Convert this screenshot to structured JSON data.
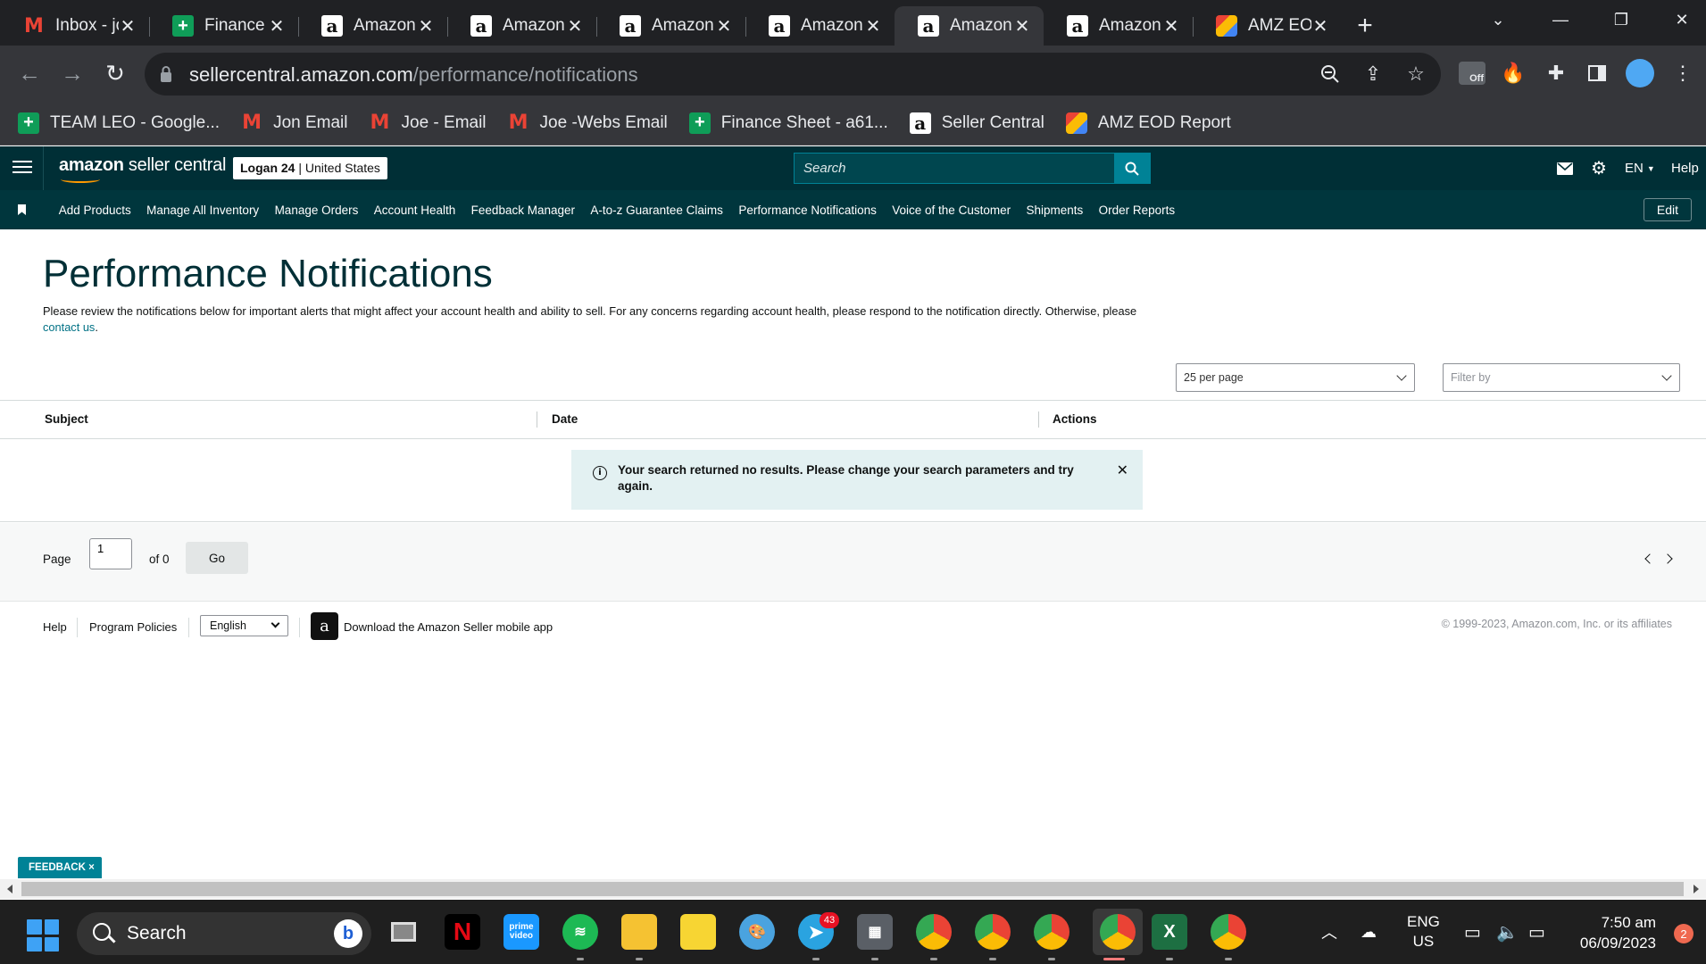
{
  "browser": {
    "tabs": [
      {
        "title": "Inbox - jo",
        "favicon": "gmail-icon"
      },
      {
        "title": "Finance S",
        "favicon": "sheets-icon"
      },
      {
        "title": "Amazon",
        "favicon": "amazon-icon"
      },
      {
        "title": "Amazon",
        "favicon": "amazon-icon"
      },
      {
        "title": "Amazon",
        "favicon": "amazon-icon"
      },
      {
        "title": "Amazon",
        "favicon": "amazon-icon"
      },
      {
        "title": "Amazon",
        "favicon": "amazon-icon",
        "active": true
      },
      {
        "title": "Amazon",
        "favicon": "amazon-icon"
      },
      {
        "title": "AMZ EOI",
        "favicon": "amz-eod-icon"
      }
    ],
    "url_host": "sellercentral.amazon.com",
    "url_path": "/performance/notifications",
    "extension_badge": "Off",
    "bookmarks": [
      {
        "label": "TEAM LEO - Google...",
        "favicon": "sheets-icon"
      },
      {
        "label": "Jon Email",
        "favicon": "gmail-icon"
      },
      {
        "label": "Joe - Email",
        "favicon": "gmail-icon"
      },
      {
        "label": "Joe -Webs Email",
        "favicon": "gmail-icon"
      },
      {
        "label": "Finance Sheet - a61...",
        "favicon": "sheets-icon"
      },
      {
        "label": "Seller Central",
        "favicon": "amazon-icon"
      },
      {
        "label": "AMZ EOD Report",
        "favicon": "amz-eod-icon"
      }
    ]
  },
  "header": {
    "logo_amazon": "amazon",
    "logo_rest": " seller central",
    "account_name": "Logan 24",
    "account_region": " | United States",
    "search_placeholder": "Search",
    "language": "EN",
    "help": "Help"
  },
  "nav": {
    "items": [
      "Add Products",
      "Manage All Inventory",
      "Manage Orders",
      "Account Health",
      "Feedback Manager",
      "A-to-z Guarantee Claims",
      "Performance Notifications",
      "Voice of the Customer",
      "Shipments",
      "Order Reports"
    ],
    "edit": "Edit"
  },
  "page": {
    "title": "Performance Notifications",
    "intro": "Please review the notifications below for important alerts that might affect your account health and ability to sell. For any concerns regarding account health, please respond to the notification directly. Otherwise, please ",
    "intro_link": "contact us",
    "intro_end": ".",
    "per_page": "25 per page",
    "filter_placeholder": "Filter by",
    "columns": [
      "Subject",
      "Date",
      "Actions"
    ],
    "empty_message": "Your search returned no results. Please change your search parameters and try again.",
    "pager": {
      "page_label": "Page",
      "page_value": "1",
      "of_label": "of 0",
      "go": "Go"
    }
  },
  "footer": {
    "help": "Help",
    "program_policies": "Program Policies",
    "language": "English",
    "app_download": "Download the Amazon Seller mobile app",
    "copyright": "© 1999-2023, Amazon.com, Inc. or its affiliates"
  },
  "feedback": {
    "label": "FEEDBACK ×"
  },
  "taskbar": {
    "search": "Search",
    "telegram_badge": "43",
    "lang_top": "ENG",
    "lang_bottom": "US",
    "time": "7:50 am",
    "date": "06/09/2023",
    "notifications": "2"
  },
  "colors": {
    "header_bg": "#002f36",
    "nav_bg": "#00363d",
    "accent": "#008296",
    "link": "#007185"
  }
}
